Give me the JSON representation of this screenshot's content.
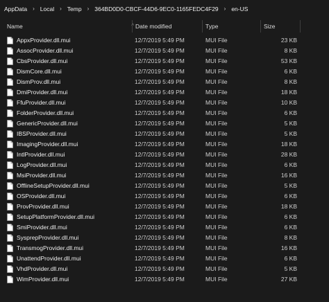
{
  "breadcrumb": [
    "AppData",
    "Local",
    "Temp",
    "364BD0D0-CBCF-44D6-9EC0-1165FEDC4F29",
    "en-US"
  ],
  "columns": {
    "name": "Name",
    "date": "Date modified",
    "type": "Type",
    "size": "Size"
  },
  "sort_indicator": "^",
  "files": [
    {
      "name": "AppxProvider.dll.mui",
      "date": "12/7/2019 5:49 PM",
      "type": "MUI File",
      "size": "23 KB"
    },
    {
      "name": "AssocProvider.dll.mui",
      "date": "12/7/2019 5:49 PM",
      "type": "MUI File",
      "size": "8 KB"
    },
    {
      "name": "CbsProvider.dll.mui",
      "date": "12/7/2019 5:49 PM",
      "type": "MUI File",
      "size": "53 KB"
    },
    {
      "name": "DismCore.dll.mui",
      "date": "12/7/2019 5:49 PM",
      "type": "MUI File",
      "size": "6 KB"
    },
    {
      "name": "DismProv.dll.mui",
      "date": "12/7/2019 5:49 PM",
      "type": "MUI File",
      "size": "8 KB"
    },
    {
      "name": "DmiProvider.dll.mui",
      "date": "12/7/2019 5:49 PM",
      "type": "MUI File",
      "size": "18 KB"
    },
    {
      "name": "FfuProvider.dll.mui",
      "date": "12/7/2019 5:49 PM",
      "type": "MUI File",
      "size": "10 KB"
    },
    {
      "name": "FolderProvider.dll.mui",
      "date": "12/7/2019 5:49 PM",
      "type": "MUI File",
      "size": "6 KB"
    },
    {
      "name": "GenericProvider.dll.mui",
      "date": "12/7/2019 5:49 PM",
      "type": "MUI File",
      "size": "5 KB"
    },
    {
      "name": "IBSProvider.dll.mui",
      "date": "12/7/2019 5:49 PM",
      "type": "MUI File",
      "size": "5 KB"
    },
    {
      "name": "ImagingProvider.dll.mui",
      "date": "12/7/2019 5:49 PM",
      "type": "MUI File",
      "size": "18 KB"
    },
    {
      "name": "IntlProvider.dll.mui",
      "date": "12/7/2019 5:49 PM",
      "type": "MUI File",
      "size": "28 KB"
    },
    {
      "name": "LogProvider.dll.mui",
      "date": "12/7/2019 5:49 PM",
      "type": "MUI File",
      "size": "6 KB"
    },
    {
      "name": "MsiProvider.dll.mui",
      "date": "12/7/2019 5:49 PM",
      "type": "MUI File",
      "size": "16 KB"
    },
    {
      "name": "OfflineSetupProvider.dll.mui",
      "date": "12/7/2019 5:49 PM",
      "type": "MUI File",
      "size": "5 KB"
    },
    {
      "name": "OSProvider.dll.mui",
      "date": "12/7/2019 5:49 PM",
      "type": "MUI File",
      "size": "6 KB"
    },
    {
      "name": "ProvProvider.dll.mui",
      "date": "12/7/2019 5:49 PM",
      "type": "MUI File",
      "size": "18 KB"
    },
    {
      "name": "SetupPlatformProvider.dll.mui",
      "date": "12/7/2019 5:49 PM",
      "type": "MUI File",
      "size": "6 KB"
    },
    {
      "name": "SmiProvider.dll.mui",
      "date": "12/7/2019 5:49 PM",
      "type": "MUI File",
      "size": "6 KB"
    },
    {
      "name": "SysprepProvider.dll.mui",
      "date": "12/7/2019 5:49 PM",
      "type": "MUI File",
      "size": "8 KB"
    },
    {
      "name": "TransmogProvider.dll.mui",
      "date": "12/7/2019 5:49 PM",
      "type": "MUI File",
      "size": "16 KB"
    },
    {
      "name": "UnattendProvider.dll.mui",
      "date": "12/7/2019 5:49 PM",
      "type": "MUI File",
      "size": "6 KB"
    },
    {
      "name": "VhdProvider.dll.mui",
      "date": "12/7/2019 5:49 PM",
      "type": "MUI File",
      "size": "5 KB"
    },
    {
      "name": "WimProvider.dll.mui",
      "date": "12/7/2019 5:49 PM",
      "type": "MUI File",
      "size": "27 KB"
    }
  ],
  "icons": {
    "separator": "chevron-right-icon",
    "file": "file-icon"
  },
  "colors": {
    "background": "#1b1b1b",
    "text": "#e6e6e6",
    "divider": "#3e3e3e"
  }
}
